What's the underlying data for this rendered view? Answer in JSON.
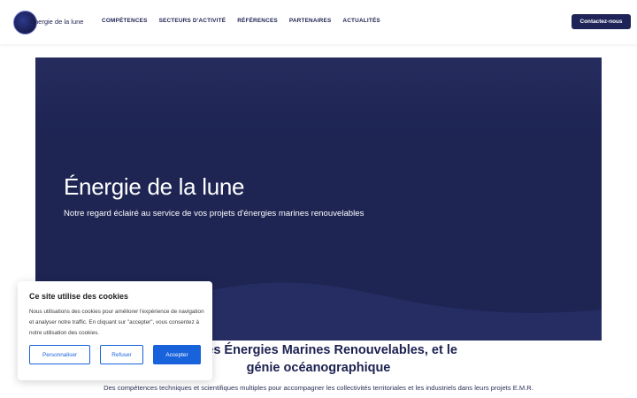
{
  "header": {
    "logo_text": "Énergie de la lune",
    "nav": [
      "COMPÉTENCES",
      "SECTEURS D'ACTIVITÉ",
      "RÉFÉRENCES",
      "PARTENAIRES",
      "ACTUALITÉS"
    ],
    "contact_label": "Contactez-nous"
  },
  "hero": {
    "title": "Énergie de la lune",
    "subtitle": "Notre regard éclairé au service de vos projets d'énergies marines renouvelables"
  },
  "section": {
    "title_line1": "spécialisé dans les Énergies Marines Renouvelables, et le",
    "title_line2": "génie océanographique",
    "description": "Des compétences techniques et scientifiques multiples pour accompagner les collectivités territoriales et les industriels dans leurs projets E.M.R."
  },
  "cookie": {
    "title": "Ce site utilise des cookies",
    "text": "Nous utilisations des cookies pour améliorer l'expérience de navigation et analyser notre traffic. En cliquant sur \"accepter\", vous consentez à notre utilisation des cookies.",
    "customize_label": "Personnaliser",
    "reject_label": "Refuser",
    "accept_label": "Accepter"
  },
  "colors": {
    "navy": "#1e2553",
    "button_blue": "#1863dc"
  }
}
